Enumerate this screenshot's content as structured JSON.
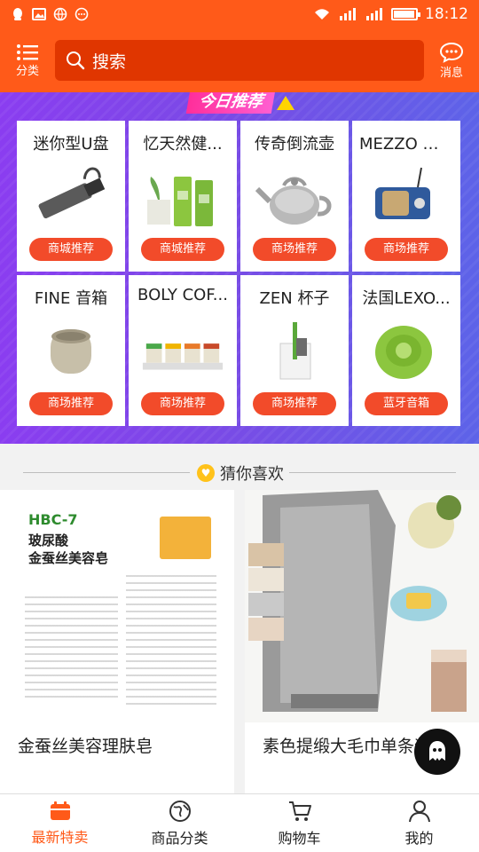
{
  "status_bar": {
    "time": "18:12",
    "battery_level": 0.95
  },
  "header": {
    "menu_label": "分类",
    "search_placeholder": "搜索",
    "message_label": "消息"
  },
  "banner": {
    "title": "今日推荐",
    "cards": [
      {
        "title": "迷你型U盘",
        "tag": "商城推荐"
      },
      {
        "title": "忆天然健...",
        "tag": "商城推荐"
      },
      {
        "title": "传奇倒流壶",
        "tag": "商场推荐"
      },
      {
        "title": "MEZZO 收...",
        "tag": "商场推荐"
      },
      {
        "title": "FINE 音箱",
        "tag": "商场推荐"
      },
      {
        "title": "BOLY COF...",
        "tag": "商场推荐"
      },
      {
        "title": "ZEN 杯子",
        "tag": "商场推荐"
      },
      {
        "title": "法国LEXO...",
        "tag": "蓝牙音箱"
      }
    ]
  },
  "guess": {
    "title": "猜你喜欢",
    "products": [
      {
        "name": "金蚕丝美容理肤皂",
        "img_heading": "HBC-7",
        "img_sub1": "玻尿酸",
        "img_sub2": "金蚕丝美容皂"
      },
      {
        "name": "素色提缎大毛巾单条装"
      }
    ]
  },
  "bottom_nav": [
    {
      "label": "最新特卖",
      "icon": "calendar-icon",
      "active": true
    },
    {
      "label": "商品分类",
      "icon": "globe-icon",
      "active": false
    },
    {
      "label": "购物车",
      "icon": "cart-icon",
      "active": false
    },
    {
      "label": "我的",
      "icon": "user-icon",
      "active": false
    }
  ],
  "colors": {
    "brand": "#ff5a19",
    "tag": "#f24b2a",
    "active_nav": "#ff5a19"
  }
}
